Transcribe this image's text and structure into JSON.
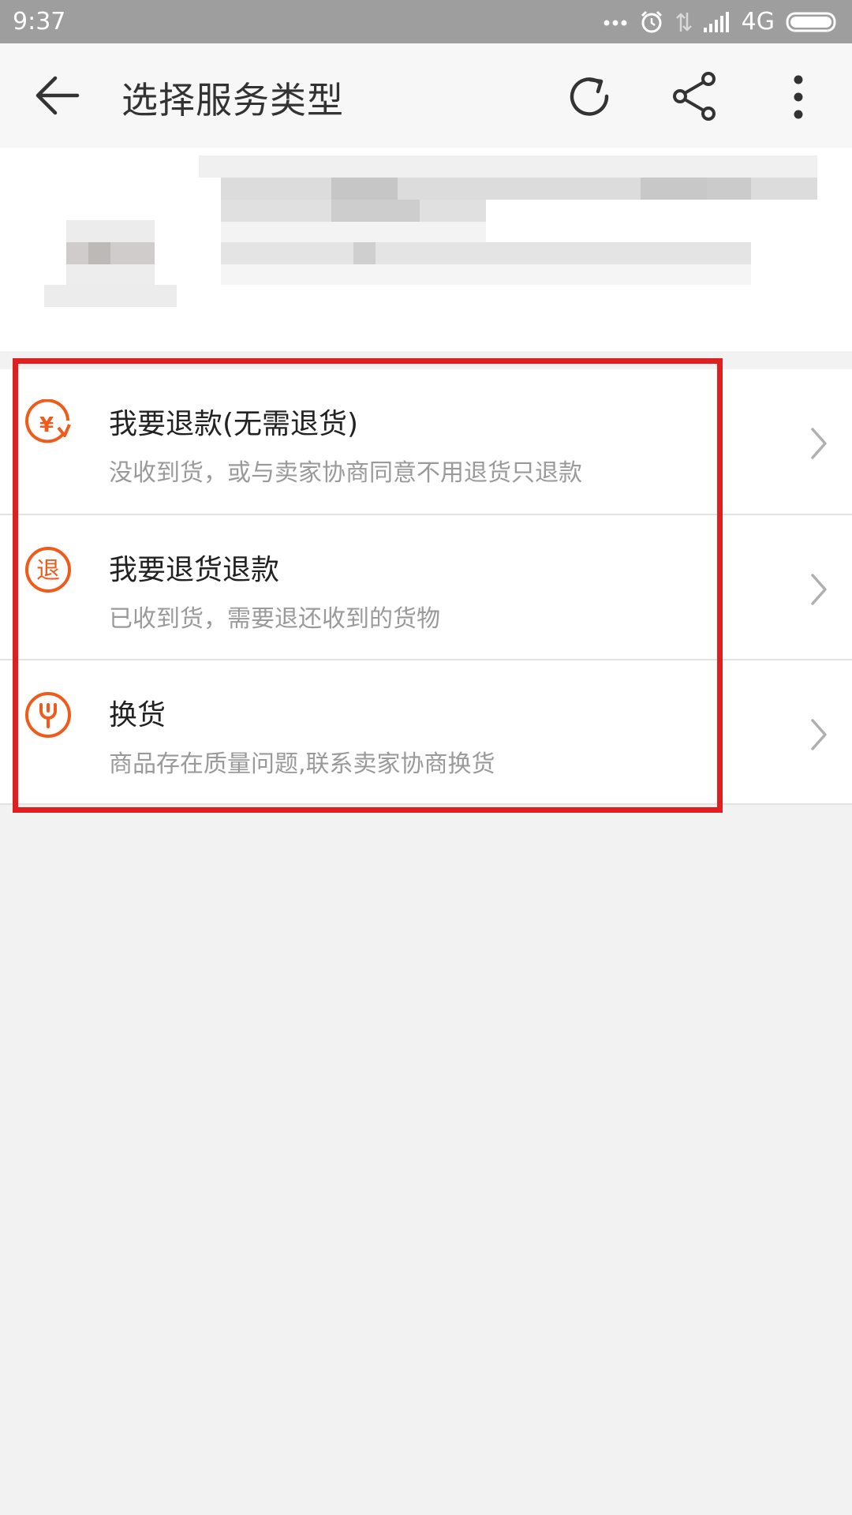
{
  "status_bar": {
    "time": "9:37",
    "network": "4G"
  },
  "toolbar": {
    "title": "选择服务类型",
    "icons": [
      "back-arrow-icon",
      "refresh-icon",
      "share-icon",
      "more-vertical-icon"
    ]
  },
  "options": [
    {
      "title": "我要退款(无需退货)",
      "subtitle": "没收到货，或与卖家协商同意不用退货只退款",
      "icon": "refund-yen-icon",
      "icon_glyph": "¥"
    },
    {
      "title": "我要退货退款",
      "subtitle": "已收到货，需要退还收到的货物",
      "icon": "return-tui-icon",
      "icon_glyph": "退"
    },
    {
      "title": "换货",
      "subtitle": "商品存在质量问题,联系卖家协商换货",
      "icon": "exchange-wrench-icon",
      "icon_glyph": ""
    }
  ],
  "colors": {
    "accent": "#f05a1a",
    "highlight": "#e02020",
    "status_bar": "#9e9e9e"
  }
}
